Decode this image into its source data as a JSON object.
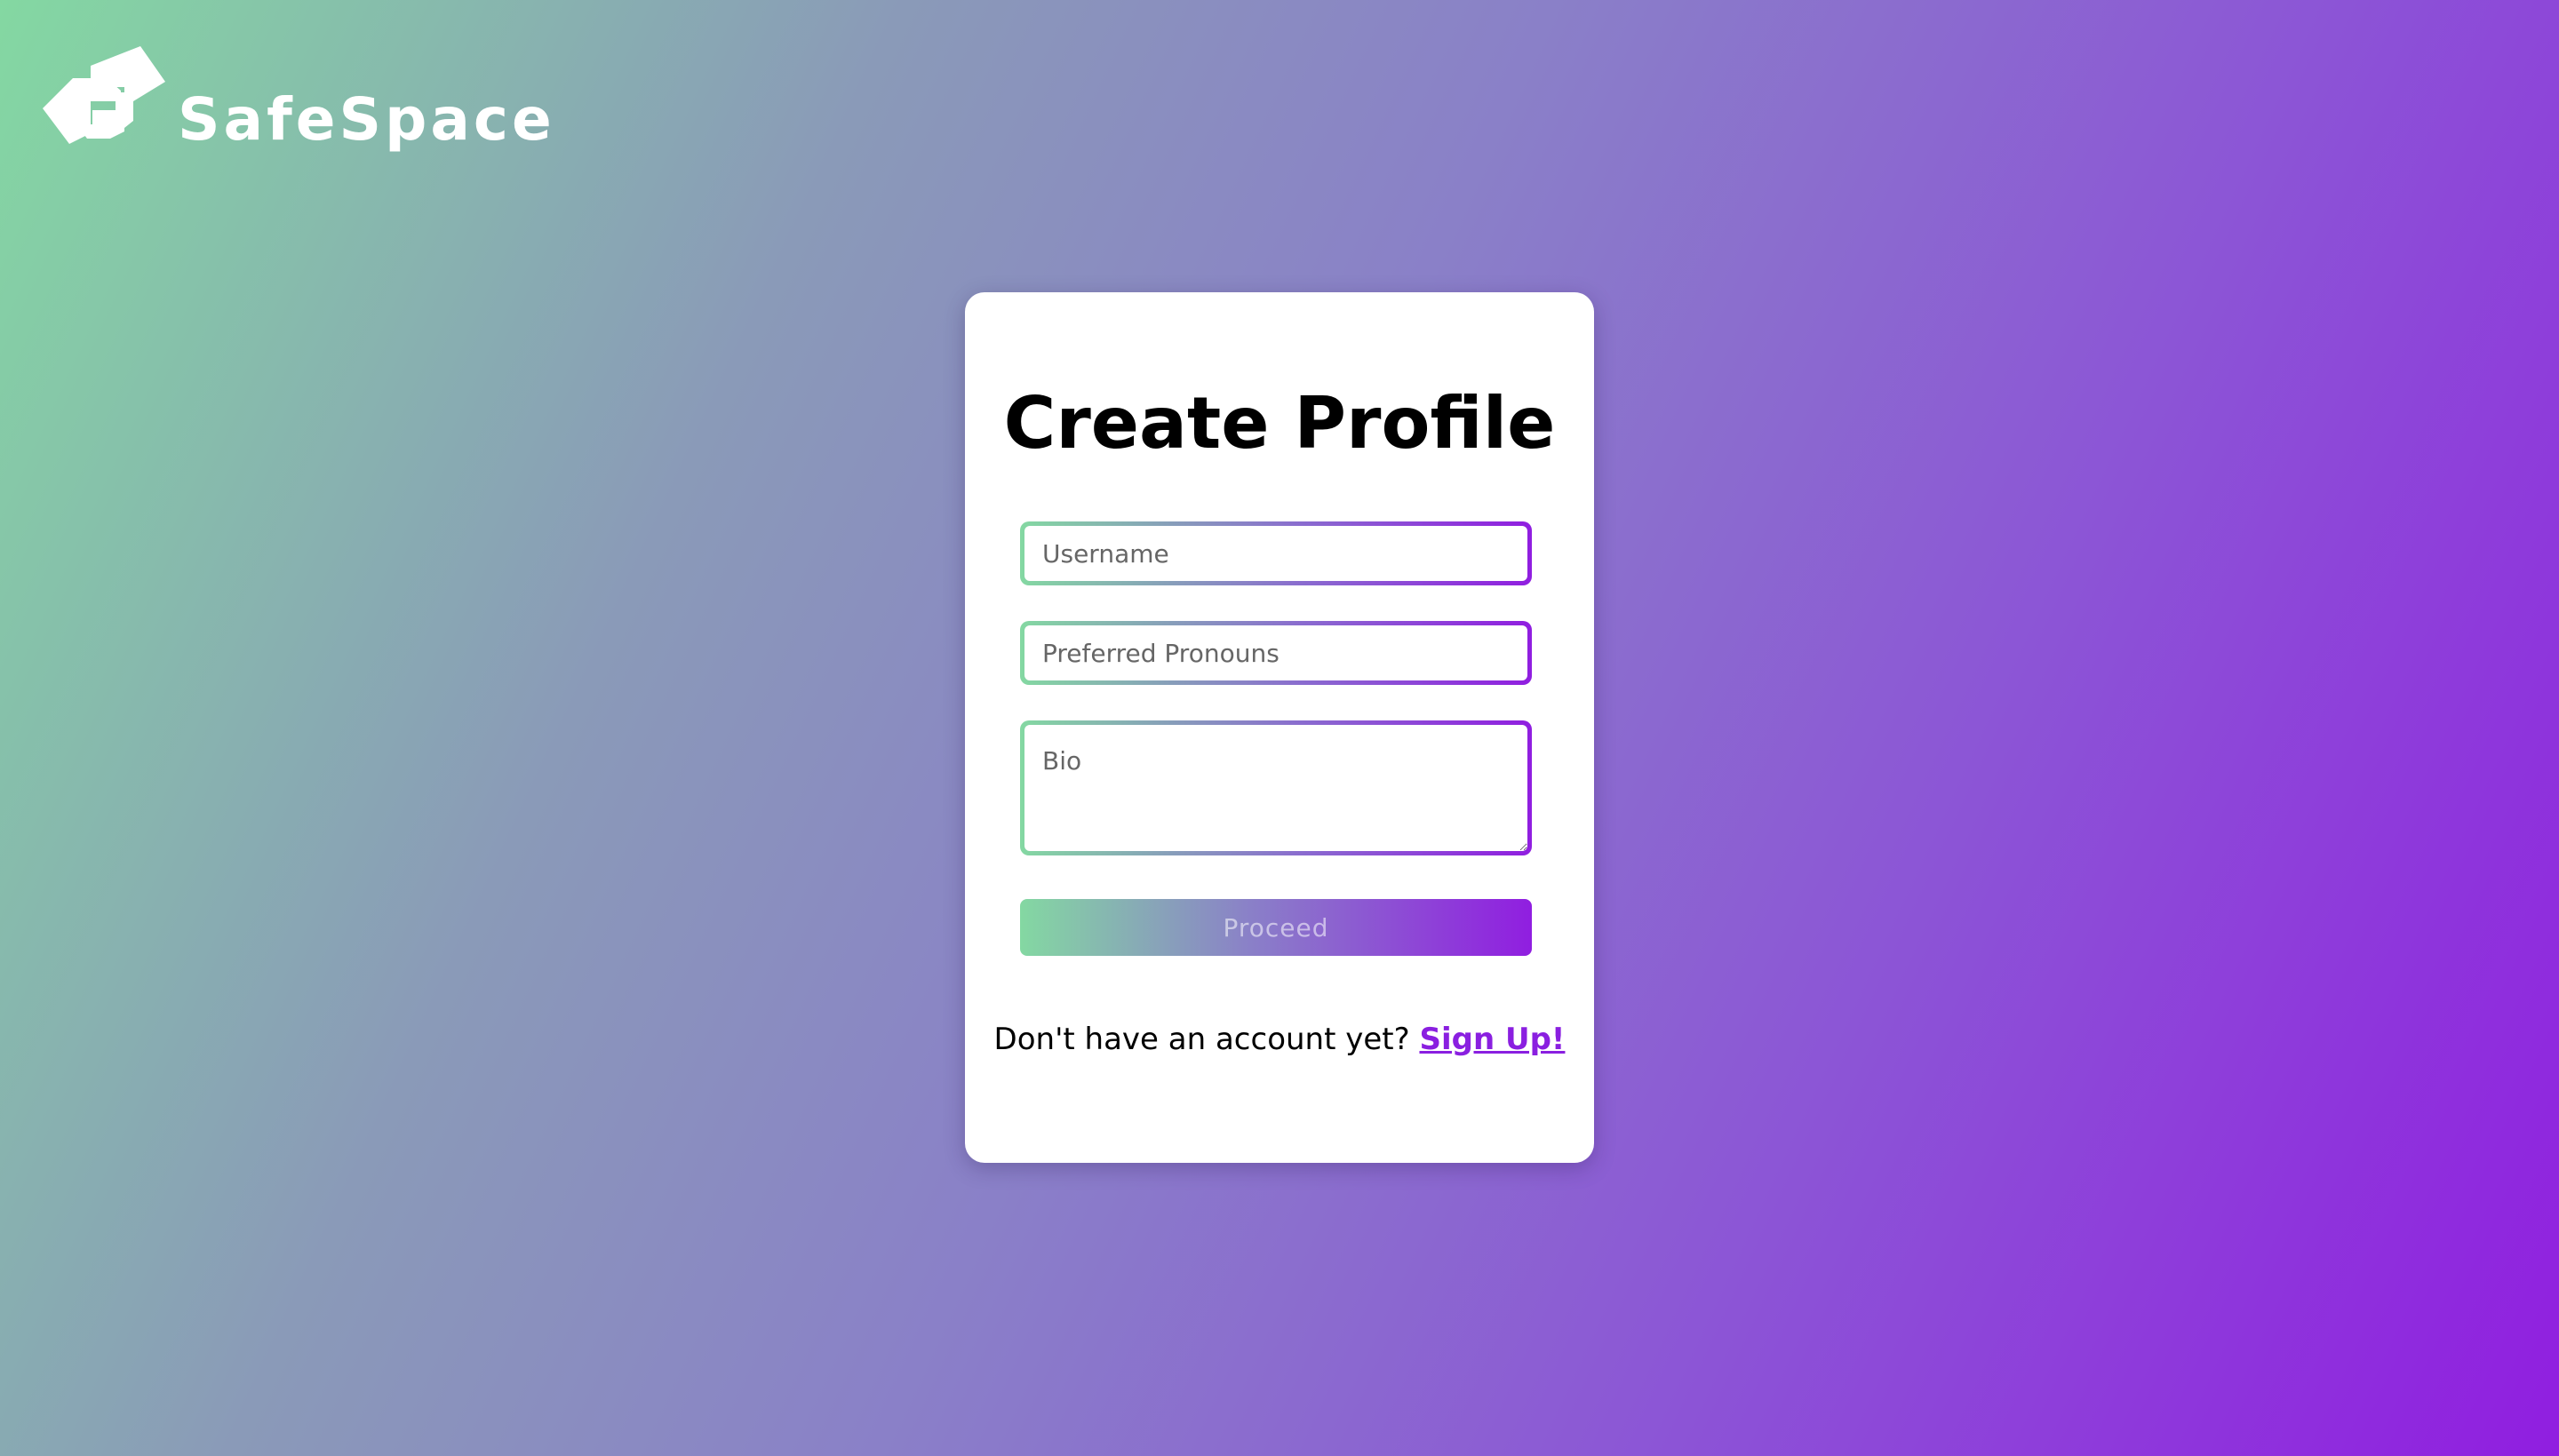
{
  "brand": {
    "name": "SafeSpace",
    "logo_icon": "linked-hands-icon"
  },
  "form": {
    "title": "Create Profile",
    "username": {
      "placeholder": "Username",
      "value": ""
    },
    "pronouns": {
      "placeholder": "Preferred Pronouns",
      "value": ""
    },
    "bio": {
      "placeholder": "Bio",
      "value": ""
    },
    "proceed_label": "Proceed",
    "signup_prompt": "Don't have an account yet?",
    "signup_link": "Sign Up!"
  },
  "colors": {
    "gradient_start": "#84d8a2",
    "gradient_end": "#901ee0",
    "link": "#8a1fe0",
    "card": "#ffffff"
  }
}
